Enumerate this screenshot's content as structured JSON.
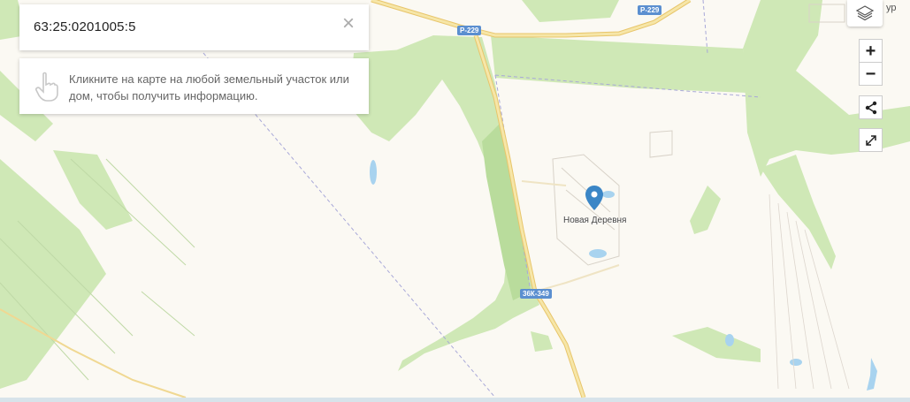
{
  "search": {
    "value": "63:25:0201005:5",
    "close_glyph": "×"
  },
  "hint": {
    "icon": "hand-pointer-icon",
    "text": "Кликните на карте на любой земельный участок или дом, чтобы получить информацию."
  },
  "controls": {
    "layers_icon": "layers-icon",
    "zoom_in": "+",
    "zoom_out": "−",
    "share_icon": "share-icon",
    "fullscreen_icon": "expand-icon"
  },
  "map": {
    "place_name": "Новая Деревня",
    "roads": [
      {
        "label": "Р-229"
      },
      {
        "label": "Р-229"
      },
      {
        "label": "36К-349"
      }
    ],
    "edge_label": "ур",
    "colors": {
      "background": "#fbf9f3",
      "forest": "#cfe8b6",
      "forest_dark": "#b9dc9c",
      "highway": "#f2d98a",
      "water": "#a8d3ef",
      "marker": "#3b86c6",
      "boundary": "#a8a8d8"
    }
  }
}
